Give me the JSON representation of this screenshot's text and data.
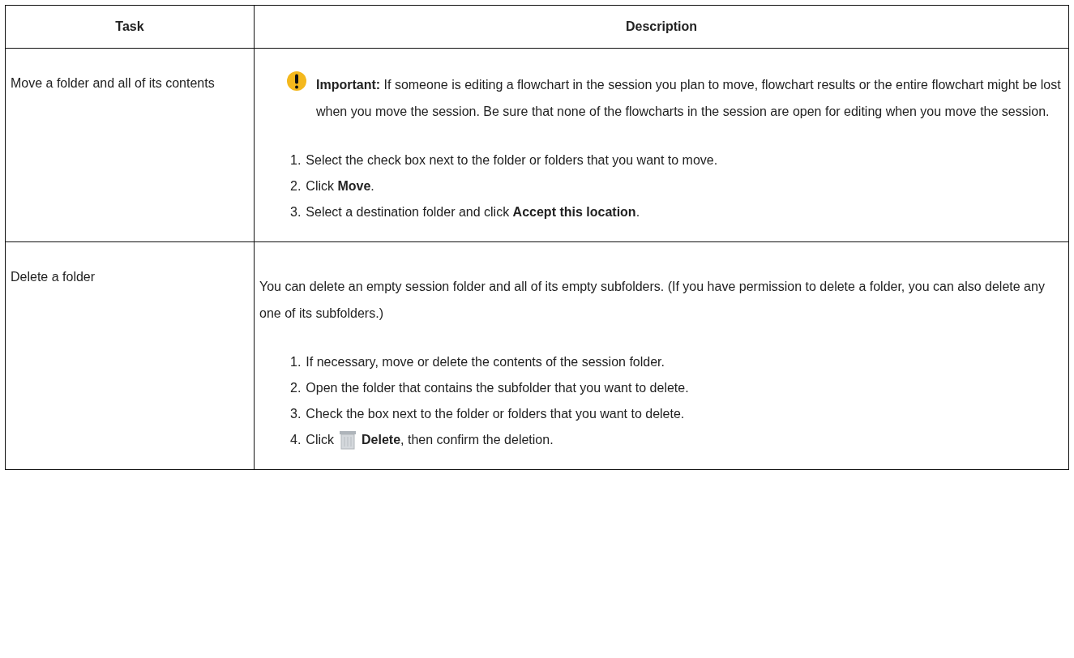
{
  "table": {
    "columns": [
      "Task",
      "Description"
    ],
    "rows": [
      {
        "task": "Move a folder and all of its contents",
        "note": {
          "kind": "important",
          "text": "**Important:** If someone is editing a flowchart in the session you plan to move, flowchart results or the entire flowchart might be lost when you move the session. Be sure that none of the flowcharts in the session are open for editing when you move the session."
        },
        "steps": [
          {
            "kind": "text",
            "number": "1.",
            "text": "Select the check box next to the folder or folders that you want to move."
          },
          {
            "kind": "text",
            "number": "2.",
            "text": "Click **Move**."
          },
          {
            "kind": "text",
            "number": "3.",
            "text": "Select a destination folder and click **Accept this location**."
          }
        ]
      },
      {
        "task": "Delete a folder",
        "paragraph": "You can delete an empty session folder and all of its empty subfolders. (If you have permission to delete a folder, you can also delete any one of its subfolders.)",
        "steps": [
          {
            "kind": "text",
            "number": "1.",
            "text": "If necessary, move or delete the contents of the session folder."
          },
          {
            "kind": "text",
            "number": "2.",
            "text": "Open the folder that contains the subfolder that you want to delete."
          },
          {
            "kind": "text",
            "number": "3.",
            "text": "Check the box next to the folder or folders that you want to delete."
          },
          {
            "kind": "icon",
            "number": "4.",
            "before": "Click",
            "text": "**Delete**, then confirm the deletion."
          }
        ]
      }
    ]
  }
}
